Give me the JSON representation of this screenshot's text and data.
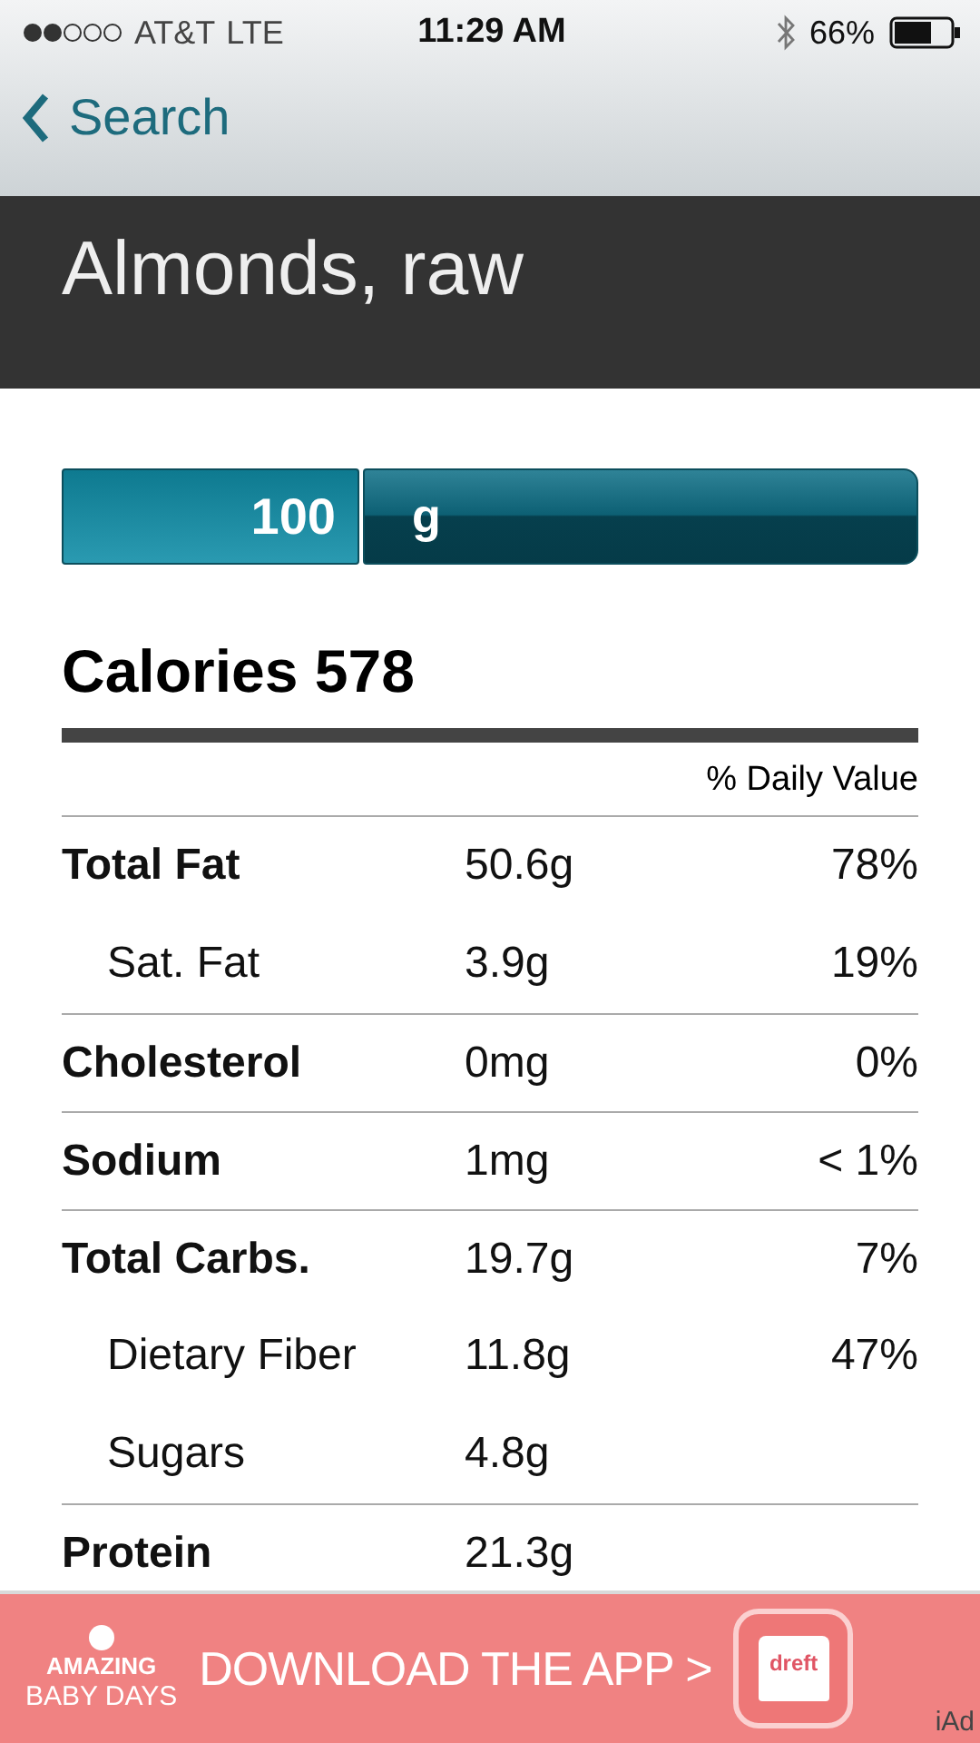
{
  "status_bar": {
    "carrier": "AT&T",
    "network": "LTE",
    "time": "11:29 AM",
    "battery": "66%"
  },
  "nav": {
    "back": "Search"
  },
  "title": "Almonds, raw",
  "serving": {
    "amount": "100",
    "unit": "g"
  },
  "calories": "Calories 578",
  "dv_header": "% Daily Value",
  "rows": [
    {
      "kind": "main",
      "name": "Total Fat",
      "amount": "50.6g",
      "dv": "78%"
    },
    {
      "kind": "sub",
      "name": "Sat. Fat",
      "amount": "3.9g",
      "dv": "19%"
    },
    {
      "kind": "main",
      "name": "Cholesterol",
      "amount": "0mg",
      "dv": "0%"
    },
    {
      "kind": "main",
      "name": "Sodium",
      "amount": "1mg",
      "dv": "< 1%"
    },
    {
      "kind": "main",
      "name": "Total Carbs.",
      "amount": "19.7g",
      "dv": "7%"
    },
    {
      "kind": "sub",
      "name": "Dietary Fiber",
      "amount": "11.8g",
      "dv": "47%"
    },
    {
      "kind": "sub",
      "name": "Sugars",
      "amount": "4.8g"
    },
    {
      "kind": "main",
      "name": "Protein",
      "amount": "21.3g"
    }
  ],
  "ad": {
    "brand_top": "AMAZING",
    "brand_bottom": "BABY DAYS",
    "cta": "DOWNLOAD THE APP >",
    "app_label": "dreft",
    "network": "iAd"
  }
}
